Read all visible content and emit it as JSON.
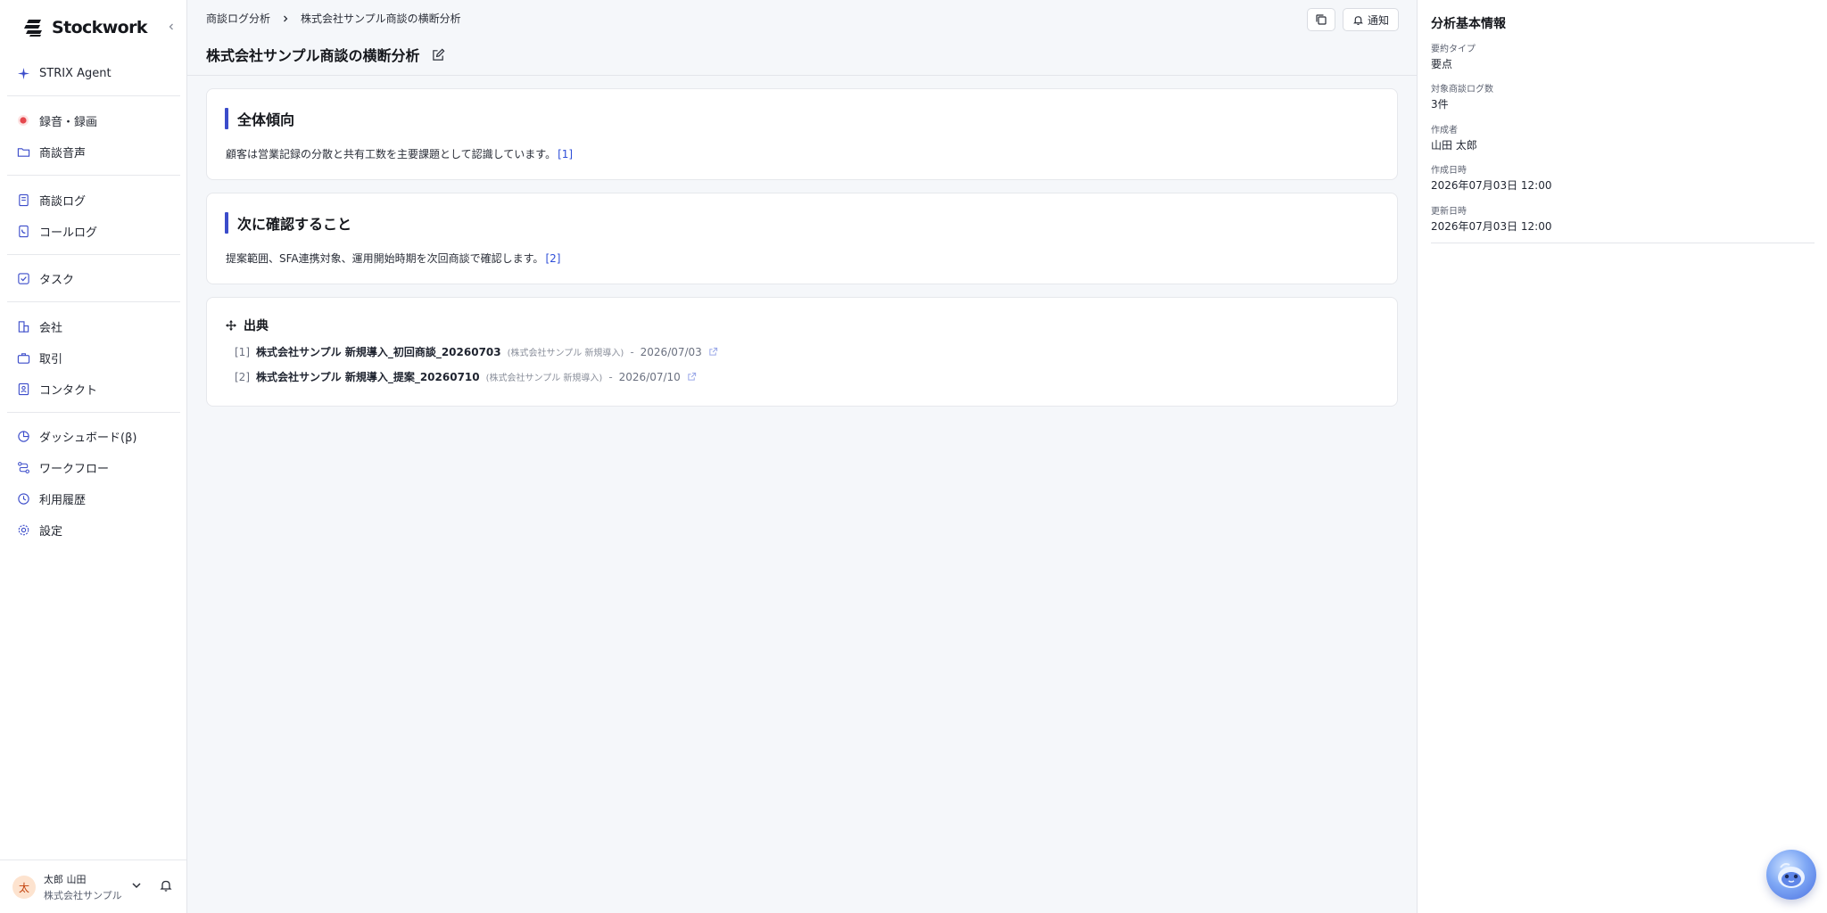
{
  "sidebar": {
    "brand": "Stockwork",
    "items": [
      {
        "label": "STRIX Agent"
      },
      {
        "label": "録音・録画"
      },
      {
        "label": "商談音声"
      },
      {
        "label": "商談ログ"
      },
      {
        "label": "コールログ"
      },
      {
        "label": "タスク"
      },
      {
        "label": "会社"
      },
      {
        "label": "取引"
      },
      {
        "label": "コンタクト"
      },
      {
        "label": "ダッシュボード(β)"
      },
      {
        "label": "ワークフロー"
      },
      {
        "label": "利用履歴"
      },
      {
        "label": "設定"
      }
    ],
    "user": {
      "avatar_initial": "太",
      "name": "太郎 山田",
      "org": "株式会社サンプル"
    }
  },
  "header": {
    "breadcrumb": [
      "商談ログ分析",
      "株式会社サンプル商談の横断分析"
    ],
    "notify_label": "通知",
    "title": "株式会社サンプル商談の横断分析"
  },
  "sections": [
    {
      "title": "全体傾向",
      "body": "顧客は営業記録の分散と共有工数を主要課題として認識しています。",
      "cite": "[1]"
    },
    {
      "title": "次に確認すること",
      "body": "提案範囲、SFA連携対象、運用開始時期を次回商談で確認します。",
      "cite": "[2]"
    }
  ],
  "sources": {
    "title": "出典",
    "items": [
      {
        "num": "[1]",
        "title": "株式会社サンプル 新規導入_初回商談_20260703",
        "meta": "(株式会社サンプル 新規導入)",
        "dash": "-",
        "date": "2026/07/03"
      },
      {
        "num": "[2]",
        "title": "株式会社サンプル 新規導入_提案_20260710",
        "meta": "(株式会社サンプル 新規導入)",
        "dash": "-",
        "date": "2026/07/10"
      }
    ]
  },
  "info": {
    "title": "分析基本情報",
    "fields": [
      {
        "label": "要約タイプ",
        "value": "要点"
      },
      {
        "label": "対象商談ログ数",
        "value": "3件"
      },
      {
        "label": "作成者",
        "value": "山田 太郎"
      },
      {
        "label": "作成日時",
        "value": "2026年07月03日 12:00"
      },
      {
        "label": "更新日時",
        "value": "2026年07月03日 12:00"
      }
    ]
  },
  "colors": {
    "accent": "#3b4cca",
    "link": "#2f4fd8",
    "record_dot": "#e5484d"
  }
}
